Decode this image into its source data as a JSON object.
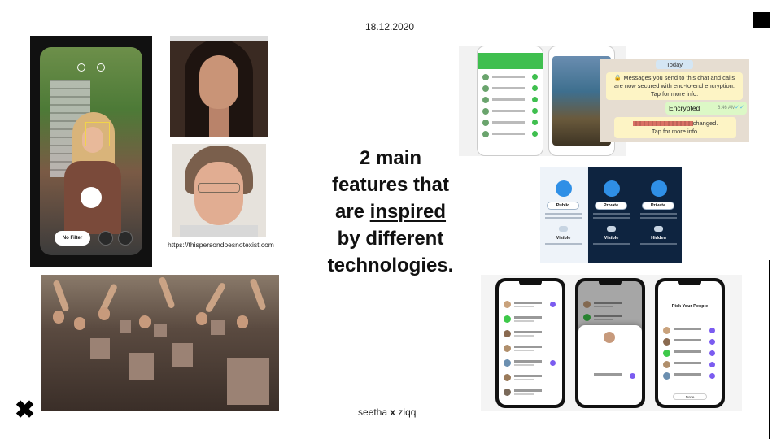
{
  "slide": {
    "date": "18.12.2020",
    "headline": {
      "line1": "2 main",
      "line2": "features that",
      "line3_prefix": "are ",
      "line3_underlined": "inspired",
      "line4": "by different",
      "line5": "technologies."
    },
    "credit": {
      "name_left": "seetha",
      "separator": "x",
      "name_right": "ziqq"
    },
    "image_source_url": "https://thispersondoesnotexist.com"
  },
  "screenshots": {
    "camera": {
      "filter_pill": "No Filter"
    },
    "whatsapp": {
      "date_chip": "Today",
      "system_message": "Messages you send to this chat and calls are now secured with end-to-end encryption. Tap for more info.",
      "encrypted_message": "Encrypted",
      "encrypted_time": "6:46 AM",
      "changed_suffix": "changed.",
      "changed_tap": "Tap for more info."
    },
    "privacy_cards": [
      {
        "tag": "Public",
        "visibility": "Visible"
      },
      {
        "tag": "Private",
        "visibility": "Visible"
      },
      {
        "tag": "Private",
        "visibility": "Hidden"
      }
    ],
    "messenger": {
      "pick_title": "Pick Your People",
      "done_label": "Done"
    }
  },
  "colors": {
    "accent_black": "#000000",
    "whatsapp_green": "#dcf8c6",
    "messenger_purple": "#7b5cf0"
  }
}
